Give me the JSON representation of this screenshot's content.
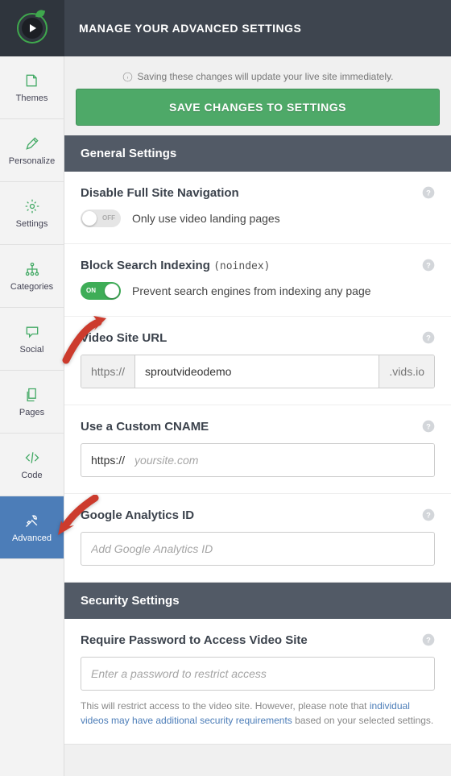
{
  "header": {
    "title": "MANAGE YOUR ADVANCED SETTINGS"
  },
  "sidebar": {
    "items": [
      {
        "label": "Themes"
      },
      {
        "label": "Personalize"
      },
      {
        "label": "Settings"
      },
      {
        "label": "Categories"
      },
      {
        "label": "Social"
      },
      {
        "label": "Pages"
      },
      {
        "label": "Code"
      },
      {
        "label": "Advanced"
      }
    ]
  },
  "notice": "Saving these changes will update your live site immediately.",
  "saveButton": "SAVE CHANGES TO SETTINGS",
  "sections": {
    "general": {
      "title": "General Settings",
      "disableNav": {
        "label": "Disable Full Site Navigation",
        "toggle": "OFF",
        "desc": "Only use video landing pages"
      },
      "blockIndex": {
        "label": "Block Search Indexing",
        "paren": "(noindex)",
        "toggle": "ON",
        "desc": "Prevent search engines from indexing any page"
      },
      "siteUrl": {
        "label": "Video Site URL",
        "prefix": "https://",
        "value": "sproutvideodemo",
        "suffix": ".vids.io"
      },
      "cname": {
        "label": "Use a Custom CNAME",
        "prefix": "https://",
        "placeholder": "yoursite.com"
      },
      "ga": {
        "label": "Google Analytics ID",
        "placeholder": "Add Google Analytics ID"
      }
    },
    "security": {
      "title": "Security Settings",
      "password": {
        "label": "Require Password to Access Video Site",
        "placeholder": "Enter a password to restrict access",
        "noteA": "This will restrict access to the video site. However, please note that ",
        "noteLink": "individual videos may have additional security requirements",
        "noteB": " based on your selected settings."
      }
    }
  }
}
